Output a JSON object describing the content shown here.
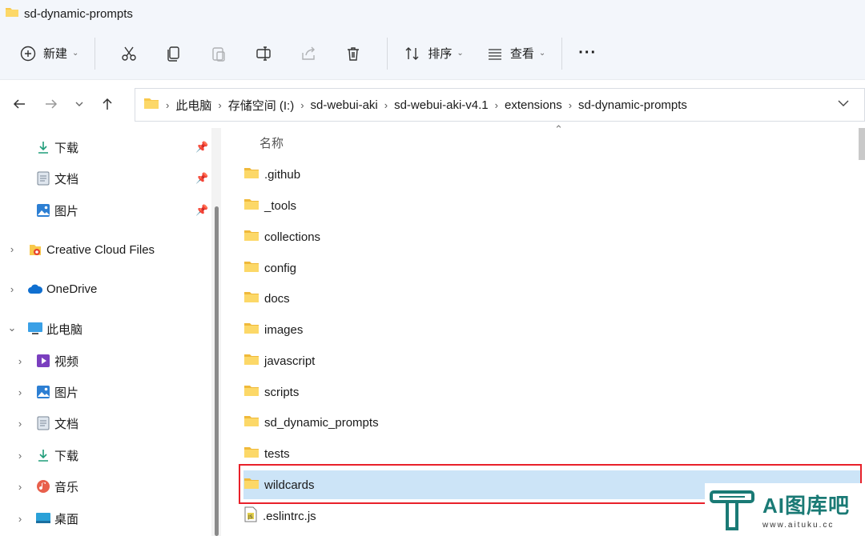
{
  "window": {
    "title": "sd-dynamic-prompts"
  },
  "toolbar": {
    "new_label": "新建",
    "sort_label": "排序",
    "view_label": "查看",
    "more_label": "···",
    "icons": [
      "cut-icon",
      "copy-icon",
      "paste-icon",
      "rename-icon",
      "share-icon",
      "delete-icon"
    ]
  },
  "breadcrumb": [
    "此电脑",
    "存储空间 (I:)",
    "sd-webui-aki",
    "sd-webui-aki-v4.1",
    "extensions",
    "sd-dynamic-prompts"
  ],
  "sidebar": {
    "quick_access": [
      {
        "label": "下载",
        "icon": "download-icon"
      },
      {
        "label": "文档",
        "icon": "document-icon"
      },
      {
        "label": "图片",
        "icon": "pictures-icon"
      }
    ],
    "groups": [
      {
        "label": "Creative Cloud Files",
        "icon": "creative-cloud-icon"
      },
      {
        "label": "OneDrive",
        "icon": "onedrive-icon"
      },
      {
        "label": "此电脑",
        "icon": "computer-icon"
      }
    ],
    "pc_items": [
      {
        "label": "视频",
        "icon": "video-icon"
      },
      {
        "label": "图片",
        "icon": "pictures-icon"
      },
      {
        "label": "文档",
        "icon": "document-icon"
      },
      {
        "label": "下载",
        "icon": "download-icon"
      },
      {
        "label": "音乐",
        "icon": "music-icon"
      },
      {
        "label": "桌面",
        "icon": "desktop-icon"
      }
    ]
  },
  "filelist": {
    "column_name": "名称",
    "items": [
      {
        "name": ".github",
        "type": "folder"
      },
      {
        "name": "_tools",
        "type": "folder"
      },
      {
        "name": "collections",
        "type": "folder"
      },
      {
        "name": "config",
        "type": "folder"
      },
      {
        "name": "docs",
        "type": "folder"
      },
      {
        "name": "images",
        "type": "folder"
      },
      {
        "name": "javascript",
        "type": "folder"
      },
      {
        "name": "scripts",
        "type": "folder"
      },
      {
        "name": "sd_dynamic_prompts",
        "type": "folder"
      },
      {
        "name": "tests",
        "type": "folder"
      },
      {
        "name": "wildcards",
        "type": "folder",
        "selected": true
      },
      {
        "name": ".eslintrc.js",
        "type": "js-file"
      }
    ]
  },
  "watermark": {
    "name": "AI图库吧",
    "url": "www.aituku.cc"
  },
  "colors": {
    "selection": "#cce4f7",
    "highlight_border": "#e8212a",
    "folder": "#f8c84b",
    "brand": "#1a7a75"
  }
}
